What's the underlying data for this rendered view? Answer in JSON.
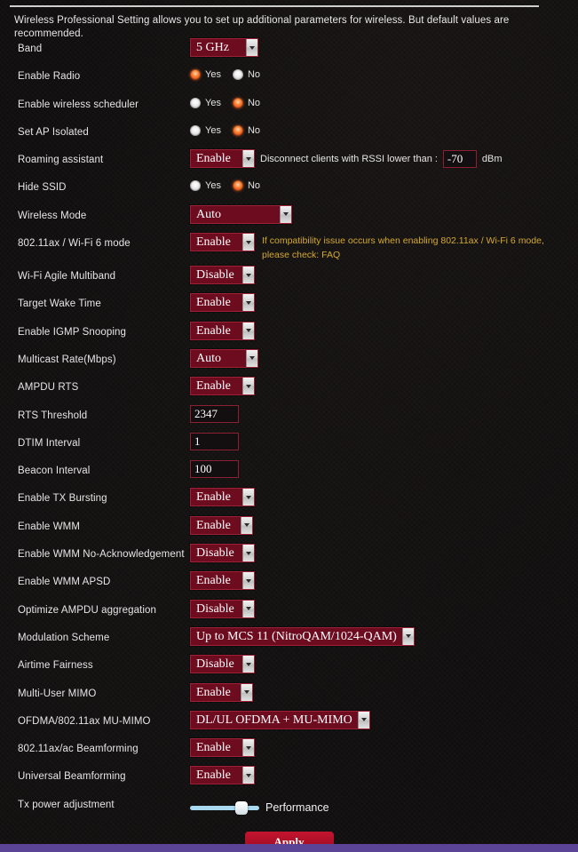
{
  "page": {
    "intro": "Wireless Professional Setting allows you to set up additional parameters for wireless. But default values are recommended.",
    "apply_label": "Apply",
    "accent_red": "#6d0b1f",
    "accent_border": "#9d2137",
    "hint_color": "#d4a82f",
    "radio_on_color": "#e3591b",
    "slider_track_color": "#a8d9f0",
    "bottom_bar_color": "#5b4496",
    "apply_button_color": "#ab0f27"
  },
  "rows": [
    {
      "label": "Band",
      "type": "select",
      "value": "5 GHz",
      "width": "sm"
    },
    {
      "label": "Enable Radio",
      "type": "radio",
      "yes_label": "Yes",
      "no_label": "No",
      "selected": "yes"
    },
    {
      "label": "Enable wireless scheduler",
      "type": "radio",
      "yes_label": "Yes",
      "no_label": "No",
      "selected": "no"
    },
    {
      "label": "Set AP Isolated",
      "type": "radio",
      "yes_label": "Yes",
      "no_label": "No",
      "selected": "no"
    },
    {
      "label": "Roaming assistant",
      "type": "select_rssi",
      "value": "Enable",
      "note": "Disconnect clients with RSSI lower than :",
      "rssi_value": "-70",
      "unit": "dBm"
    },
    {
      "label": "Hide SSID",
      "type": "radio",
      "yes_label": "Yes",
      "no_label": "No",
      "selected": "no"
    },
    {
      "label": "Wireless Mode",
      "type": "select",
      "value": "Auto",
      "width": "md"
    },
    {
      "label": "802.11ax / Wi-Fi 6 mode",
      "type": "select_hint",
      "value": "Enable",
      "hint": "If compatibility issue occurs when enabling 802.11ax / Wi-Fi 6 mode, please check: ",
      "hint_link": "FAQ"
    },
    {
      "label": "Wi-Fi Agile Multiband",
      "type": "select",
      "value": "Disable",
      "width": "lg"
    },
    {
      "label": "Target Wake Time",
      "type": "select",
      "value": "Enable",
      "width": "lg"
    },
    {
      "label": "Enable IGMP Snooping",
      "type": "select",
      "value": "Enable",
      "width": "lg"
    },
    {
      "label": "Multicast Rate(Mbps)",
      "type": "select",
      "value": "Auto",
      "width": "sm"
    },
    {
      "label": "AMPDU RTS",
      "type": "select",
      "value": "Enable",
      "width": "lg"
    },
    {
      "label": "RTS Threshold",
      "type": "input",
      "value": "2347"
    },
    {
      "label": "DTIM Interval",
      "type": "input",
      "value": "1"
    },
    {
      "label": "Beacon Interval",
      "type": "input",
      "value": "100"
    },
    {
      "label": "Enable TX Bursting",
      "type": "select",
      "value": "Enable",
      "width": "lg"
    },
    {
      "label": "Enable WMM",
      "type": "select",
      "value": "Enable",
      "width": "xs"
    },
    {
      "label": "Enable WMM No-Acknowledgement",
      "type": "select",
      "value": "Disable",
      "width": "lg"
    },
    {
      "label": "Enable WMM APSD",
      "type": "select",
      "value": "Enable",
      "width": "lg"
    },
    {
      "label": "Optimize AMPDU aggregation",
      "type": "select",
      "value": "Disable",
      "width": "lg"
    },
    {
      "label": "Modulation Scheme",
      "type": "select",
      "value": "Up to MCS 11 (NitroQAM/1024-QAM)",
      "width": "xl"
    },
    {
      "label": "Airtime Fairness",
      "type": "select",
      "value": "Disable",
      "width": "lg"
    },
    {
      "label": "Multi-User MIMO",
      "type": "select",
      "value": "Enable",
      "width": "xs"
    },
    {
      "label": "OFDMA/802.11ax MU-MIMO",
      "type": "select",
      "value": "DL/UL OFDMA + MU-MIMO",
      "width": "xl"
    },
    {
      "label": "802.11ax/ac Beamforming",
      "type": "select",
      "value": "Enable",
      "width": "lg"
    },
    {
      "label": "Universal Beamforming",
      "type": "select",
      "value": "Enable",
      "width": "lg"
    },
    {
      "label": "Tx power adjustment",
      "type": "slider",
      "value_label": "Performance",
      "position_percent": 80
    }
  ]
}
